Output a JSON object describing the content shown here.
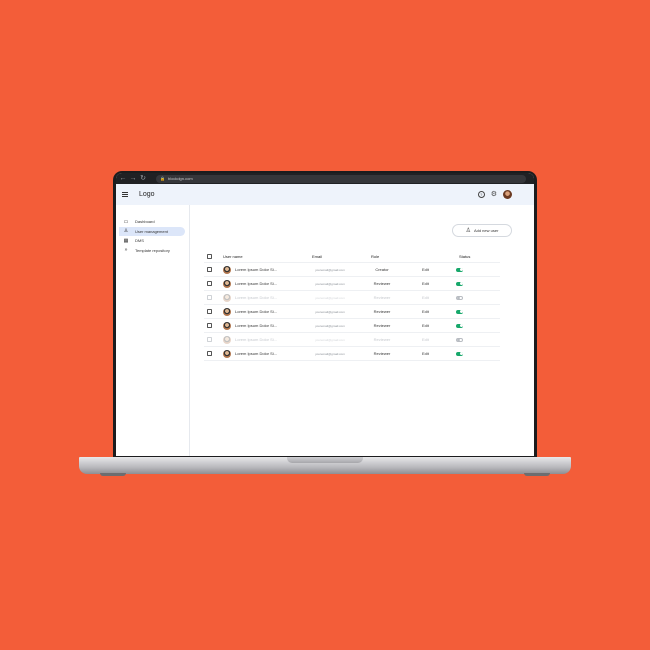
{
  "browser": {
    "back_icon": "arrow-left-icon",
    "forward_icon": "arrow-right-icon",
    "reload_icon": "reload-icon",
    "url": "blockdgn.com"
  },
  "header": {
    "logo": "Logo"
  },
  "sidebar": {
    "items": [
      {
        "label": "Dashboard",
        "icon": "monitor-icon",
        "active": false
      },
      {
        "label": "User management",
        "icon": "user-icon",
        "active": true
      },
      {
        "label": "DMS",
        "icon": "calendar-icon",
        "active": false
      },
      {
        "label": "Template repository",
        "icon": "double-chevron-icon",
        "active": false
      }
    ]
  },
  "main": {
    "add_button": "Add new user",
    "columns": {
      "name": "User name",
      "email": "Email",
      "role": "Role",
      "status": "Status"
    },
    "rows": [
      {
        "name": "Lorem Ipsum Dolor Si...",
        "email": "youremail@gmail.com",
        "role": "Creator",
        "action": "Edit",
        "status": "on",
        "disabled": false
      },
      {
        "name": "Lorem Ipsum Dolor Si...",
        "email": "youremail@gmail.com",
        "role": "Reviewer",
        "action": "Edit",
        "status": "on",
        "disabled": false
      },
      {
        "name": "Lorem Ipsum Dolor Si...",
        "email": "youremail@gmail.com",
        "role": "Reviewer",
        "action": "Edit",
        "status": "off",
        "disabled": true
      },
      {
        "name": "Lorem Ipsum Dolor Si...",
        "email": "youremail@gmail.com",
        "role": "Reviewer",
        "action": "Edit",
        "status": "on",
        "disabled": false
      },
      {
        "name": "Lorem Ipsum Dolor Si...",
        "email": "youremail@gmail.com",
        "role": "Reviewer",
        "action": "Edit",
        "status": "on",
        "disabled": false
      },
      {
        "name": "Lorem Ipsum Dolor Si...",
        "email": "youremail@gmail.com",
        "role": "Reviewer",
        "action": "Edit",
        "status": "off",
        "disabled": true
      },
      {
        "name": "Lorem Ipsum Dolor Si...",
        "email": "youremail@gmail.com",
        "role": "Reviewer",
        "action": "Edit",
        "status": "on",
        "disabled": false
      }
    ]
  },
  "colors": {
    "background": "#F35D39",
    "toggle_on": "#17a86b",
    "active_nav": "#dce6f9",
    "header_bg": "#eef3fb"
  }
}
